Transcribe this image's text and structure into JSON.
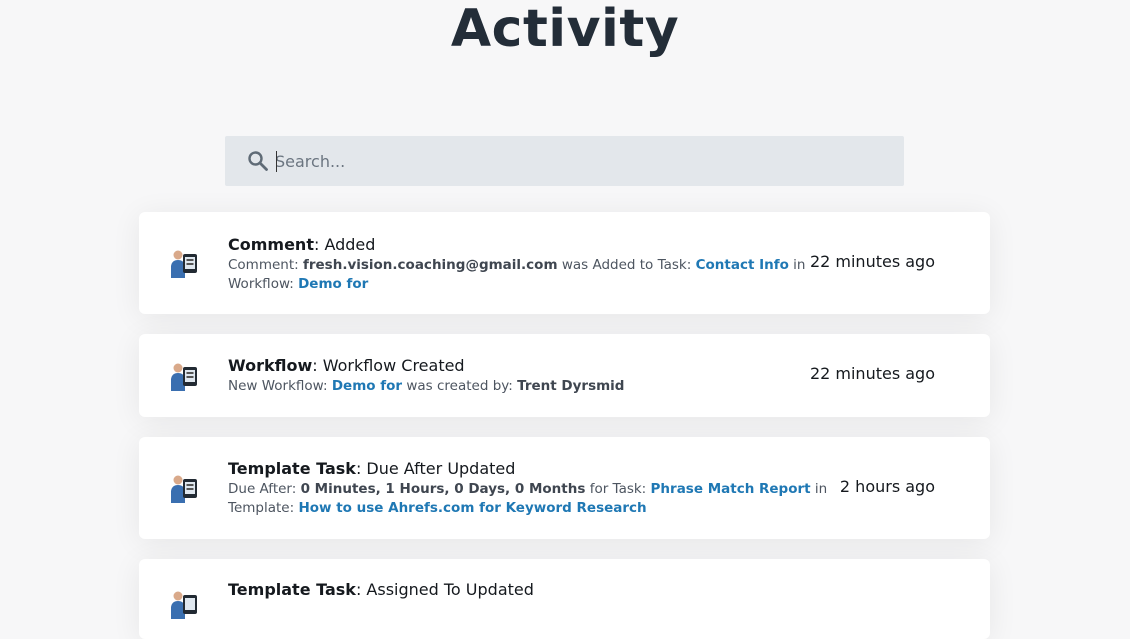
{
  "page": {
    "title": "Activity"
  },
  "search": {
    "placeholder": "Search...",
    "value": ""
  },
  "activities": [
    {
      "type_label": "Comment",
      "action": ": Added",
      "desc": {
        "p1": "Comment: ",
        "email": "fresh.vision.coaching@gmail.com",
        "p2": " was Added to Task: ",
        "task_link": "Contact Info",
        "p3": " in Workflow: ",
        "workflow_link": "Demo for"
      },
      "time": "22 minutes ago"
    },
    {
      "type_label": "Workflow",
      "action": ": Workflow Created",
      "desc": {
        "p1": "New Workflow: ",
        "workflow_link": "Demo for",
        "p2": " was created by: ",
        "user": "Trent Dyrsmid"
      },
      "time": "22 minutes ago"
    },
    {
      "type_label": "Template Task",
      "action": ": Due After Updated",
      "desc": {
        "p1": "Due After: ",
        "value": "0 Minutes, 1 Hours, 0 Days, 0 Months",
        "p2": " for Task: ",
        "task_link": "Phrase Match Report",
        "p3": " in Template: ",
        "template_link": "How to use Ahrefs.com for Keyword Research"
      },
      "time": "2 hours ago"
    },
    {
      "type_label": "Template Task",
      "action": ": Assigned To Updated"
    }
  ]
}
